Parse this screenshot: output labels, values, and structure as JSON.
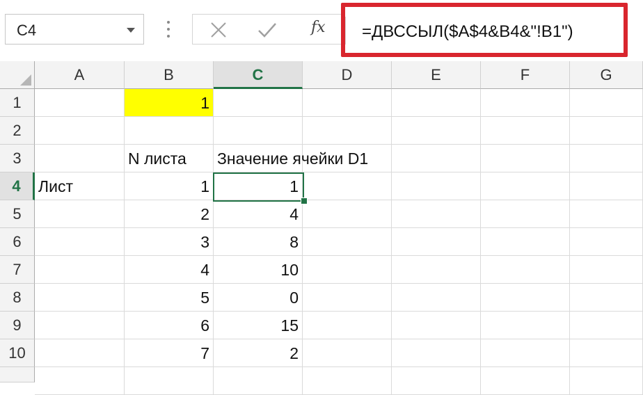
{
  "name_box": {
    "value": "C4"
  },
  "formula_bar": {
    "fx_label": "fx",
    "formula": "=ДВССЫЛ($A$4&B4&\"!B1\")",
    "highlight_color": "#d9262e"
  },
  "columns": [
    "A",
    "B",
    "C",
    "D",
    "E",
    "F",
    "G"
  ],
  "selected_column": "C",
  "rows": [
    "1",
    "2",
    "3",
    "4",
    "5",
    "6",
    "7",
    "8",
    "9",
    "10"
  ],
  "selected_row": "4",
  "cells": {
    "B1": "1",
    "B3": "N листа",
    "C3": "Значение ячейки D1",
    "A4": "Лист",
    "B4": "1",
    "C4": "1",
    "B5": "2",
    "C5": "4",
    "B6": "3",
    "C6": "8",
    "B7": "4",
    "C7": "10",
    "B8": "5",
    "C8": "0",
    "B9": "6",
    "C9": "15",
    "B10": "7",
    "C10": "2"
  },
  "colors": {
    "accent": "#217346",
    "highlight_fill": "#ffff00"
  }
}
